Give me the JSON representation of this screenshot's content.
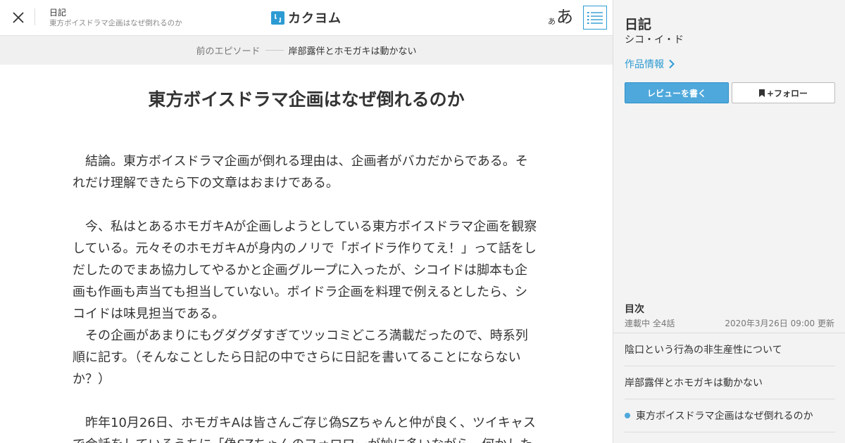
{
  "header": {
    "work_title": "日記",
    "episode_title": "東方ボイスドラマ企画はなぜ倒れるのか",
    "logo_text": "カクヨム",
    "font_small": "あ",
    "font_large": "あ"
  },
  "prev_episode": {
    "label": "前のエピソード",
    "title": "岸部露伴とホモガキは動かない"
  },
  "episode": {
    "heading": "東方ボイスドラマ企画はなぜ倒れるのか",
    "paragraphs": [
      "　結論。東方ボイスドラマ企画が倒れる理由は、企画者がバカだからである。そ",
      "れだけ理解できたら下の文章はおまけである。",
      "",
      "　今、私はとあるホモガキAが企画しようとしている東方ボイスドラマ企画を観察",
      "している。元々そのホモガキAが身内のノリで「ボイドラ作りてえ！」って話をし",
      "だしたのでまあ協力してやるかと企画グループに入ったが、シコイドは脚本も企",
      "画も作画も声当ても担当していない。ボイドラ企画を料理で例えるとしたら、シ",
      "コイドは味見担当である。",
      "　その企画があまりにもグダグダすぎてツッコミどころ満載だったので、時系列",
      "順に記す。（そんなことしたら日記の中でさらに日記を書いてることにならない",
      "か？）",
      "",
      "　昨年10月26日、ホモガキAは皆さんご存じ偽SZちゃんと仲が良く、ツイキャス",
      "で会話をしているうちに「偽SZちゃんのフォロワーが妙に多いながら、何かした"
    ]
  },
  "sidebar": {
    "work_title": "日記",
    "author": "シコ・イ・ド",
    "info_link": "作品情報",
    "review_button": "レビューを書く",
    "follow_button": "+フォロー",
    "toc_heading": "目次",
    "toc_status": "連載中 全4話",
    "toc_updated": "2020年3月26日 09:00 更新",
    "toc_items": [
      "陰口という行為の非生産性について",
      "岸部露伴とホモガキは動かない",
      "東方ボイスドラマ企画はなぜ倒れるのか"
    ]
  },
  "colors": {
    "accent": "#2d9bd3",
    "review_button_bg": "#4fa8db",
    "sidebar_bg": "#f3f3f3",
    "prev_bar_bg": "#f0f0f0"
  }
}
